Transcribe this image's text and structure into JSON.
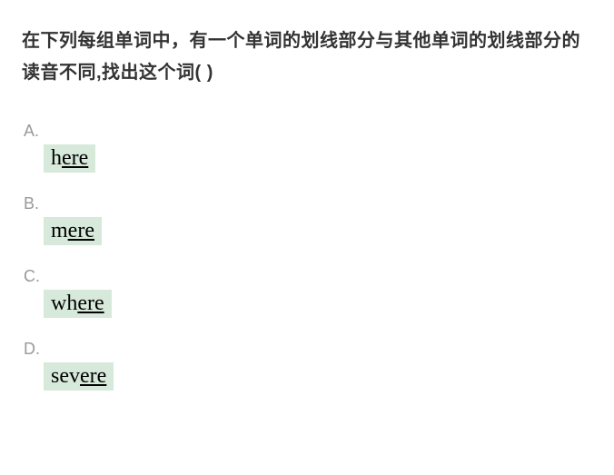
{
  "question": "在下列每组单词中，有一个单词的划线部分与其他单词的划线部分的读音不同,找出这个词(    )",
  "options": [
    {
      "label": "A.",
      "prefix": "h",
      "underlined": "ere"
    },
    {
      "label": "B.",
      "prefix": "m",
      "underlined": "ere"
    },
    {
      "label": "C.",
      "prefix": "wh",
      "underlined": "ere"
    },
    {
      "label": "D.",
      "prefix": "sev",
      "underlined": "ere"
    }
  ]
}
